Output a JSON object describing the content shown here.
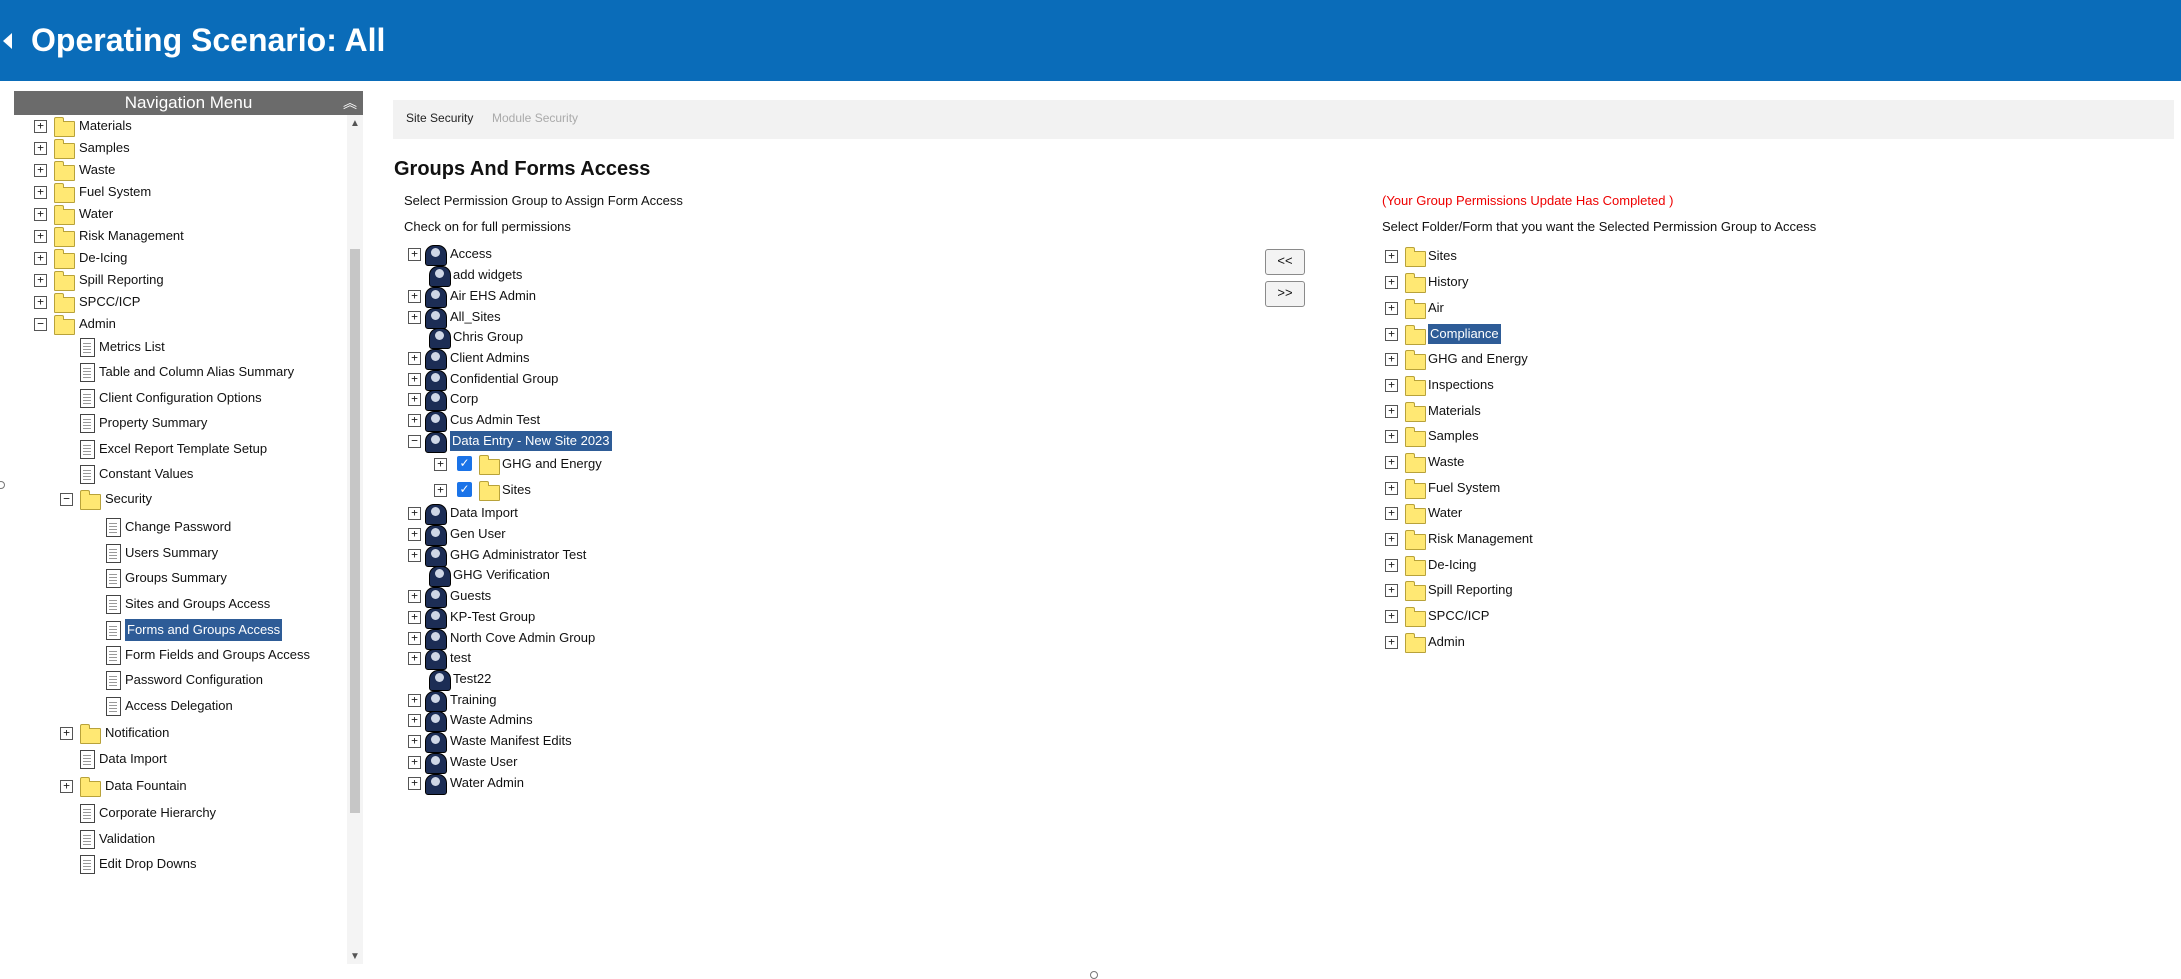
{
  "header": {
    "title": "Operating Scenario: All"
  },
  "nav": {
    "title": "Navigation Menu",
    "items": [
      {
        "label": "Materials",
        "type": "folder",
        "level": 0,
        "expander": "+"
      },
      {
        "label": "Samples",
        "type": "folder",
        "level": 0,
        "expander": "+"
      },
      {
        "label": "Waste",
        "type": "folder",
        "level": 0,
        "expander": "+"
      },
      {
        "label": "Fuel System",
        "type": "folder",
        "level": 0,
        "expander": "+"
      },
      {
        "label": "Water",
        "type": "folder",
        "level": 0,
        "expander": "+"
      },
      {
        "label": "Risk Management",
        "type": "folder",
        "level": 0,
        "expander": "+"
      },
      {
        "label": "De-Icing",
        "type": "folder",
        "level": 0,
        "expander": "+"
      },
      {
        "label": "Spill Reporting",
        "type": "folder",
        "level": 0,
        "expander": "+"
      },
      {
        "label": "SPCC/ICP",
        "type": "folder",
        "level": 0,
        "expander": "+"
      },
      {
        "label": "Admin",
        "type": "folder",
        "level": 0,
        "expander": "−"
      },
      {
        "label": "Metrics List",
        "type": "doc",
        "level": 1
      },
      {
        "label": "Table and Column Alias Summary",
        "type": "doc",
        "level": 1
      },
      {
        "label": "Client Configuration Options",
        "type": "doc",
        "level": 1
      },
      {
        "label": "Property Summary",
        "type": "doc",
        "level": 1
      },
      {
        "label": "Excel Report Template Setup",
        "type": "doc",
        "level": 1
      },
      {
        "label": "Constant Values",
        "type": "doc",
        "level": 1
      },
      {
        "label": "Security",
        "type": "folder",
        "level": 1,
        "expander": "−"
      },
      {
        "label": "Change Password",
        "type": "doc",
        "level": 2
      },
      {
        "label": "Users Summary",
        "type": "doc",
        "level": 2
      },
      {
        "label": "Groups Summary",
        "type": "doc",
        "level": 2
      },
      {
        "label": "Sites and Groups Access",
        "type": "doc",
        "level": 2
      },
      {
        "label": "Forms and Groups Access",
        "type": "doc",
        "level": 2,
        "selected": true
      },
      {
        "label": "Form Fields and Groups Access",
        "type": "doc",
        "level": 2
      },
      {
        "label": "Password Configuration",
        "type": "doc",
        "level": 2
      },
      {
        "label": "Access Delegation",
        "type": "doc",
        "level": 2
      },
      {
        "label": "Notification",
        "type": "folder",
        "level": 1,
        "expander": "+"
      },
      {
        "label": "Data Import",
        "type": "doc",
        "level": 1
      },
      {
        "label": "Data Fountain",
        "type": "folder",
        "level": 1,
        "expander": "+"
      },
      {
        "label": "Corporate Hierarchy",
        "type": "doc",
        "level": 1
      },
      {
        "label": "Validation",
        "type": "doc",
        "level": 1
      },
      {
        "label": "Edit Drop Downs",
        "type": "doc",
        "level": 1
      }
    ]
  },
  "tabs": [
    {
      "label": "Site Security",
      "active": true
    },
    {
      "label": "Module Security",
      "active": false
    }
  ],
  "main": {
    "heading": "Groups And Forms Access",
    "left_instruction": "Select Permission Group to Assign Form Access",
    "check_instruction": "Check on for full permissions",
    "status": "(Your Group Permissions Update Has Completed )",
    "right_instruction": "Select Folder/Form that you want the Selected Permission Group to Access",
    "remove_button": "<<",
    "add_button": ">>"
  },
  "groups": [
    {
      "label": "Access",
      "expander": "+",
      "level": 0
    },
    {
      "label": "add widgets",
      "level": 0
    },
    {
      "label": "Air EHS Admin",
      "expander": "+",
      "level": 0
    },
    {
      "label": "All_Sites",
      "expander": "+",
      "level": 0
    },
    {
      "label": "Chris Group",
      "level": 0
    },
    {
      "label": "Client Admins",
      "expander": "+",
      "level": 0
    },
    {
      "label": "Confidential Group",
      "expander": "+",
      "level": 0
    },
    {
      "label": "Corp",
      "expander": "+",
      "level": 0
    },
    {
      "label": "Cus Admin Test",
      "expander": "+",
      "level": 0
    },
    {
      "label": "Data Entry - New Site 2023",
      "expander": "−",
      "level": 0,
      "selected": true
    },
    {
      "label": "GHG and Energy",
      "expander": "+",
      "level": 1,
      "checked": true
    },
    {
      "label": "Sites",
      "expander": "+",
      "level": 1,
      "checked": true
    },
    {
      "label": "Data Import",
      "expander": "+",
      "level": 0
    },
    {
      "label": "Gen User",
      "expander": "+",
      "level": 0
    },
    {
      "label": "GHG Administrator Test",
      "expander": "+",
      "level": 0
    },
    {
      "label": "GHG Verification",
      "level": 0
    },
    {
      "label": "Guests",
      "expander": "+",
      "level": 0
    },
    {
      "label": "KP-Test Group",
      "expander": "+",
      "level": 0
    },
    {
      "label": "North Cove Admin Group",
      "expander": "+",
      "level": 0
    },
    {
      "label": "test",
      "expander": "+",
      "level": 0
    },
    {
      "label": "Test22",
      "level": 0
    },
    {
      "label": "Training",
      "expander": "+",
      "level": 0
    },
    {
      "label": "Waste Admins",
      "expander": "+",
      "level": 0
    },
    {
      "label": "Waste Manifest Edits",
      "expander": "+",
      "level": 0
    },
    {
      "label": "Waste User",
      "expander": "+",
      "level": 0
    },
    {
      "label": "Water Admin",
      "expander": "+",
      "level": 0
    }
  ],
  "folders": [
    {
      "label": "Sites"
    },
    {
      "label": "History"
    },
    {
      "label": "Air"
    },
    {
      "label": "Compliance",
      "selected": true
    },
    {
      "label": "GHG and Energy"
    },
    {
      "label": "Inspections"
    },
    {
      "label": "Materials"
    },
    {
      "label": "Samples"
    },
    {
      "label": "Waste"
    },
    {
      "label": "Fuel System"
    },
    {
      "label": "Water"
    },
    {
      "label": "Risk Management"
    },
    {
      "label": "De-Icing"
    },
    {
      "label": "Spill Reporting"
    },
    {
      "label": "SPCC/ICP"
    },
    {
      "label": "Admin"
    }
  ]
}
